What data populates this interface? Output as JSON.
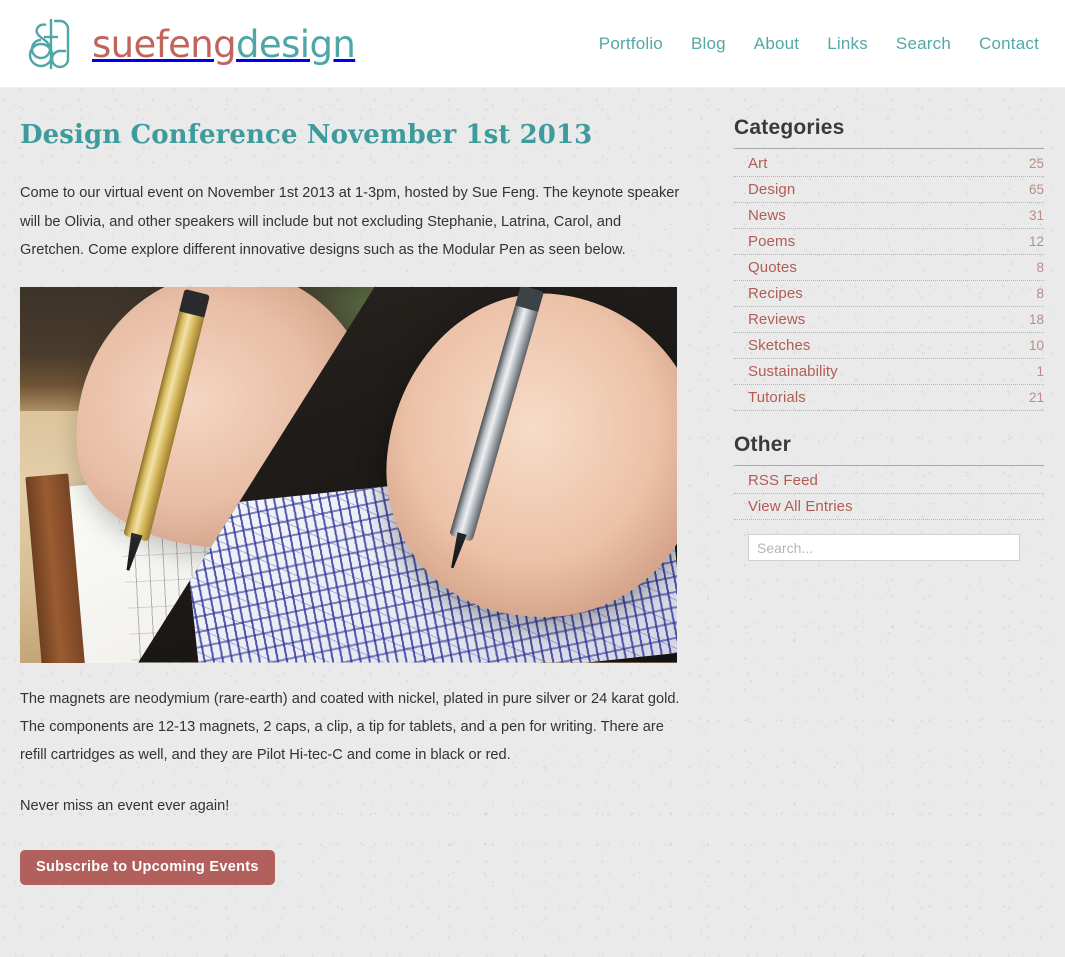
{
  "header": {
    "logo_icon": "sfd-monogram-icon",
    "wordmark_part1": "suefeng",
    "wordmark_part2": "design",
    "brand_color_red": "#c0655e",
    "brand_color_teal": "#4ea6a6",
    "nav": [
      {
        "label": "Portfolio"
      },
      {
        "label": "Blog"
      },
      {
        "label": "About"
      },
      {
        "label": "Links"
      },
      {
        "label": "Search"
      },
      {
        "label": "Contact"
      }
    ]
  },
  "post": {
    "title": "Design Conference November 1st 2013",
    "title_color": "#3d9b9b",
    "paragraph_1": "Come to our virtual event on November 1st 2013 at 1-3pm, hosted by Sue Feng. The keynote speaker will be Olivia, and other speakers will include but not excluding Stephanie, Latrina, Carol, and Gretchen. Come explore different innovative designs such as the Modular Pen as seen below.",
    "image_alt": "Hands drawing with the Modular Pen on a paper sketchbook and on a tablet",
    "paragraph_2": "The magnets are neodymium (rare-earth) and coated with nickel, plated in pure silver or 24 karat gold. The components are 12-13 magnets, 2 caps, a clip, a tip for tablets, and a pen for writing. There are refill cartridges as well, and they are Pilot Hi-tec-C and come in black or red.",
    "paragraph_3": "Never miss an event ever again!",
    "subscribe_label": "Subscribe to Upcoming Events",
    "subscribe_color": "#b2605b"
  },
  "sidebar": {
    "categories_heading": "Categories",
    "categories": [
      {
        "label": "Art",
        "count": "25"
      },
      {
        "label": "Design",
        "count": "65"
      },
      {
        "label": "News",
        "count": "31"
      },
      {
        "label": "Poems",
        "count": "12"
      },
      {
        "label": "Quotes",
        "count": "8"
      },
      {
        "label": "Recipes",
        "count": "8"
      },
      {
        "label": "Reviews",
        "count": "18"
      },
      {
        "label": "Sketches",
        "count": "10"
      },
      {
        "label": "Sustainability",
        "count": "1"
      },
      {
        "label": "Tutorials",
        "count": "21"
      }
    ],
    "other_heading": "Other",
    "other": [
      {
        "label": "RSS Feed"
      },
      {
        "label": "View All Entries"
      }
    ],
    "search_placeholder": "Search...",
    "search_value": "",
    "link_color": "#b25c54"
  }
}
